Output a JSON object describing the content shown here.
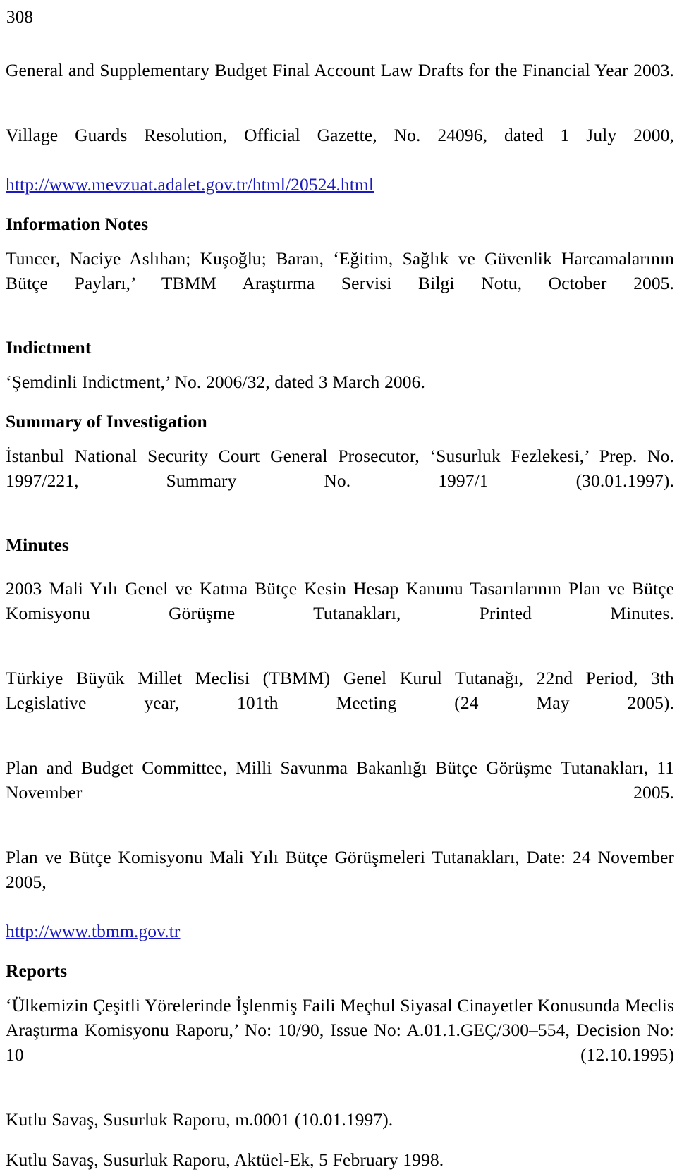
{
  "page": {
    "folio": "308",
    "link_color": "#1a1ac0",
    "text_color": "#000000",
    "background_color": "#ffffff"
  },
  "entries": {
    "budget_law_drafts": "General and Supplementary Budget Final Account Law Drafts for the Financial Year 2003.",
    "village_guards_text": "Village Guards Resolution, Official Gazette, No. 24096, dated 1 July 2000,",
    "village_guards_url": "http://www.mevzuat.adalet.gov.tr/html/20524.html"
  },
  "sections": {
    "information_notes": {
      "heading": "Information Notes",
      "entry": "Tuncer, Naciye Aslıhan; Kuşoğlu; Baran, ‘Eğitim, Sağlık ve Güvenlik Harcamalarının Bütçe Payları,’ TBMM Araştırma Servisi Bilgi Notu, October 2005."
    },
    "indictment": {
      "heading": "Indictment",
      "entry": "‘Şemdinli Indictment,’ No. 2006/32, dated 3 March 2006."
    },
    "summary_of_investigation": {
      "heading": "Summary of Investigation",
      "entry": "İstanbul National Security Court General Prosecutor, ‘Susurluk Fezlekesi,’ Prep. No. 1997/221, Summary No. 1997/1 (30.01.1997)."
    },
    "minutes": {
      "heading": "Minutes",
      "entry_1": "2003 Mali Yılı Genel ve Katma Bütçe Kesin Hesap Kanunu Tasarılarının Plan ve Bütçe Komisyonu Görüşme Tutanakları, Printed Minutes.",
      "entry_2": "Türkiye Büyük Millet Meclisi (TBMM) Genel Kurul Tutanağı, 22nd Period, 3th Legislative year, 101th Meeting (24 May 2005).",
      "entry_3": "Plan and Budget Committee, Milli Savunma Bakanlığı Bütçe Görüşme Tutanakları, 11 November 2005.",
      "entry_4_text": "Plan ve Bütçe Komisyonu Mali Yılı Bütçe Görüşmeleri Tutanakları, Date: 24 November 2005,",
      "entry_4_url": "http://www.tbmm.gov.tr"
    },
    "reports": {
      "heading": "Reports",
      "entry_1": "‘Ülkemizin Çeşitli Yörelerinde İşlenmiş Faili Meçhul Siyasal Cinayetler Konusunda Meclis Araştırma Komisyonu Raporu,’ No: 10/90, Issue No: A.01.1.GEÇ/300–554, Decision No: 10 (12.10.1995)",
      "entry_2": "Kutlu Savaş, Susurluk Raporu, m.0001 (10.01.1997).",
      "entry_3": "Kutlu Savaş, Susurluk Raporu, Aktüel-Ek, 5 February 1998."
    }
  }
}
